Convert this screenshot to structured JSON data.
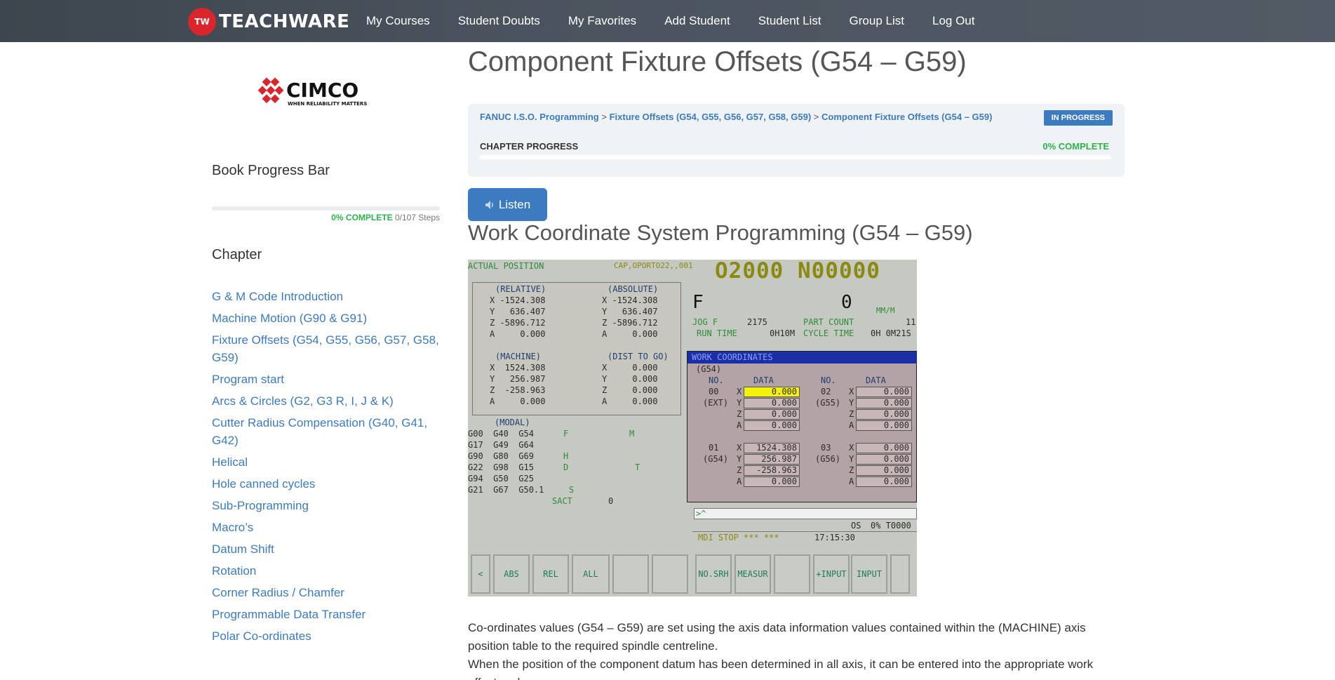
{
  "nav": {
    "logo_badge": "TW",
    "logo_text": "TEACHWARE",
    "links": [
      "My Courses",
      "Student Doubts",
      "My Favorites",
      "Add Student",
      "Student List",
      "Group List",
      "Log Out"
    ]
  },
  "sidebar": {
    "brand_logo": {
      "wordmark": "CIMCO",
      "tagline": "WHEN RELIABILITY MATTERS"
    },
    "book_progress_heading": "Book Progress Bar",
    "progress": {
      "percent": 0,
      "percent_label": "0% COMPLETE",
      "steps_label": "0/107 Steps"
    },
    "chapter_heading": "Chapter",
    "chapters": [
      "G & M Code Introduction",
      "Machine Motion (G90 & G91)",
      "Fixture Offsets (G54, G55, G56, G57, G58, G59)",
      "Program start",
      "Arcs & Circles (G2, G3 R, I, J & K)",
      "Cutter Radius Compensation (G40, G41, G42)",
      "Helical",
      "Hole canned cycles",
      "Sub-Programming",
      "Macro’s",
      "Datum Shift",
      "Rotation",
      "Corner Radius / Chamfer",
      "Programmable Data Transfer",
      "Polar Co-ordinates"
    ]
  },
  "main": {
    "page_title": "Component Fixture Offsets (G54 – G59)",
    "breadcrumb": {
      "items": [
        "FANUC I.S.O. Programming",
        "Fixture Offsets (G54, G55, G56, G57, G58, G59)",
        "Component Fixture Offsets (G54 – G59)"
      ],
      "separator": ">"
    },
    "status_badge": "IN PROGRESS",
    "chapter_progress_label": "CHAPTER PROGRESS",
    "chapter_progress": {
      "percent": 0,
      "percent_label": "0% COMPLETE"
    },
    "listen_label": "Listen",
    "section_title": "Work Coordinate System Programming (G54 – G59)",
    "paragraphs": [
      "Co-ordinates values (G54 – G59) are set using the axis data information values contained within the (MACHINE) axis position table to the required spindle centreline.",
      "When the position of the component datum has been determined in all axis, it can be entered into the appropriate work offset and"
    ]
  },
  "cnc": {
    "header_left": "ACTUAL POSITION",
    "header_mid": "CAP,OPORTO22,,001",
    "program_number": "O2000 N00000",
    "relative_label": "(RELATIVE)",
    "absolute_label": "(ABSOLUTE)",
    "relative": [
      "X -1524.308",
      "Y   636.407",
      "Z -5896.712",
      "A     0.000"
    ],
    "absolute": [
      "X -1524.308",
      "Y   636.407",
      "Z -5896.712",
      "A     0.000"
    ],
    "machine_label": "(MACHINE)",
    "dist_label": "(DIST TO GO)",
    "machine": [
      "X  1524.308",
      "Y   256.987",
      "Z  -258.963",
      "A     0.000"
    ],
    "dist": [
      "X     0.000",
      "Y     0.000",
      "Z     0.000",
      "A     0.000"
    ],
    "modal_label": "(MODAL)",
    "modal_rows": [
      "G00  G40  G54",
      "G17  G49  G64",
      "G90  G80  G69",
      "G22  G98  G15",
      "G94  G50  G25",
      "G21  G67  G50.1"
    ],
    "modal_letters": [
      "F",
      "M",
      "H",
      "D",
      "T",
      "S"
    ],
    "sact_label": "SACT",
    "sact_value": "0",
    "f_label": "F",
    "f_value": "0",
    "feed_unit": "MM/M",
    "jog_f_label": "JOG F",
    "jog_f_value": "2175",
    "part_count_label": "PART COUNT",
    "part_count_value": "11",
    "run_time_label": "RUN TIME",
    "run_time_value": "0H10M",
    "cycle_time_label": "CYCLE TIME",
    "cycle_time_value": "0H 0M21S",
    "work_coordinates_title": "WORK COORDINATES",
    "work_selected": "(G54)",
    "col_no": "NO.",
    "col_data": "DATA",
    "groups": [
      {
        "no": "00",
        "name": "(EXT)",
        "values": [
          "0.000",
          "0.000",
          "0.000",
          "0.000"
        ]
      },
      {
        "no": "02",
        "name": "(G55)",
        "values": [
          "0.000",
          "0.000",
          "0.000",
          "0.000"
        ]
      },
      {
        "no": "01",
        "name": "(G54)",
        "values": [
          "1524.308",
          "256.987",
          "-258.963",
          "0.000"
        ]
      },
      {
        "no": "03",
        "name": "(G56)",
        "values": [
          "0.000",
          "0.000",
          "0.000",
          "0.000"
        ]
      }
    ],
    "axes": [
      "X",
      "Y",
      "Z",
      "A"
    ],
    "input_prompt": ">^",
    "os_label": "OS",
    "os_value": "0% T0000",
    "status_line": "MDI STOP *** ***",
    "clock": "17:15:30",
    "softkeys": [
      "<",
      "ABS",
      "REL",
      "ALL",
      "",
      "",
      "NO.SRH",
      "MEASUR",
      "",
      "+INPUT",
      "INPUT",
      ""
    ]
  }
}
